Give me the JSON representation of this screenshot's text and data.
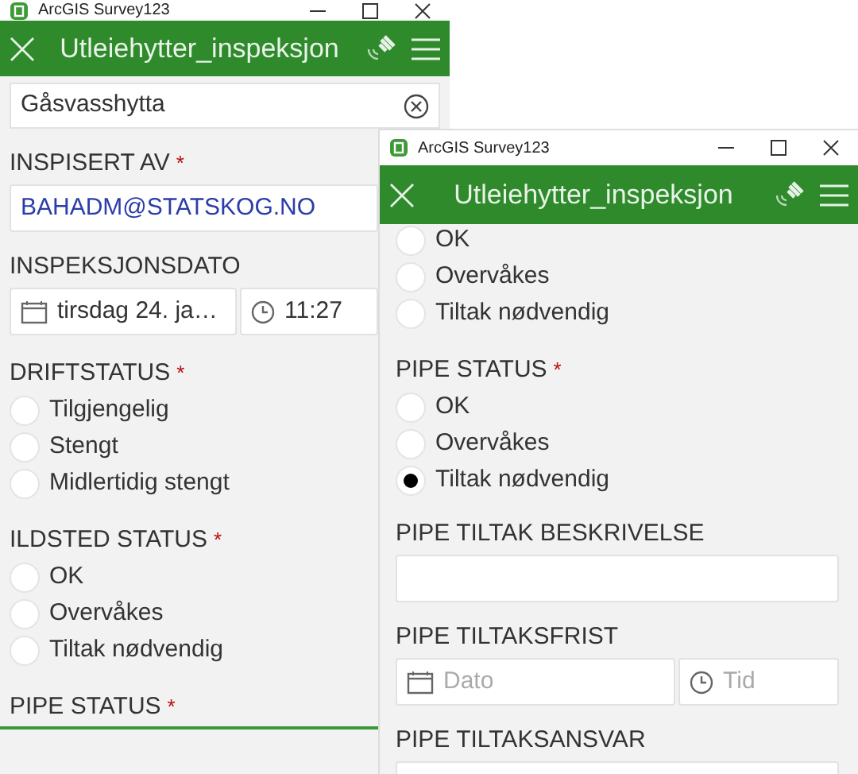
{
  "windows": [
    {
      "app_title": "ArcGIS Survey123",
      "header_title": "Utleiehytter_inspeksjon",
      "fields": [
        {
          "kind": "search",
          "value": "Gåsvasshytta"
        },
        {
          "kind": "text",
          "label": "INSPISERT AV",
          "required_mark": "*",
          "value": "BAHADM@STATSKOG.NO"
        },
        {
          "kind": "datetime",
          "label": "INSPEKSJONSDATO",
          "date": {
            "value": "tirsdag 24. ja…"
          },
          "time": {
            "value": "11:27"
          }
        },
        {
          "kind": "radio",
          "label": "DRIFTSTATUS",
          "required_mark": "*",
          "options": [
            {
              "label": "Tilgjengelig",
              "selected": false
            },
            {
              "label": "Stengt",
              "selected": false
            },
            {
              "label": "Midlertidig stengt",
              "selected": false
            }
          ]
        },
        {
          "kind": "radio",
          "label": "ILDSTED STATUS",
          "required_mark": "*",
          "options": [
            {
              "label": "OK",
              "selected": false
            },
            {
              "label": "Overvåkes",
              "selected": false
            },
            {
              "label": "Tiltak nødvendig",
              "selected": false
            }
          ]
        },
        {
          "kind": "radio",
          "label": "PIPE STATUS",
          "required_mark": "*",
          "focused": true
        }
      ]
    },
    {
      "app_title": "ArcGIS Survey123",
      "header_title": "Utleiehytter_inspeksjon",
      "fields": [
        {
          "kind": "radio",
          "options": [
            {
              "label": "OK",
              "selected": false
            },
            {
              "label": "Overvåkes",
              "selected": false
            },
            {
              "label": "Tiltak nødvendig",
              "selected": false
            }
          ]
        },
        {
          "kind": "radio",
          "label": "PIPE STATUS",
          "required_mark": "*",
          "options": [
            {
              "label": "OK",
              "selected": false
            },
            {
              "label": "Overvåkes",
              "selected": false
            },
            {
              "label": "Tiltak nødvendig",
              "selected": true
            }
          ]
        },
        {
          "kind": "text",
          "label": "PIPE TILTAK BESKRIVELSE"
        },
        {
          "kind": "datetime",
          "label": "PIPE TILTAKSFRIST",
          "date": {
            "placeholder": "Dato"
          },
          "time": {
            "placeholder": "Tid"
          }
        },
        {
          "kind": "text",
          "label": "PIPE TILTAKSANSVAR"
        }
      ]
    }
  ]
}
